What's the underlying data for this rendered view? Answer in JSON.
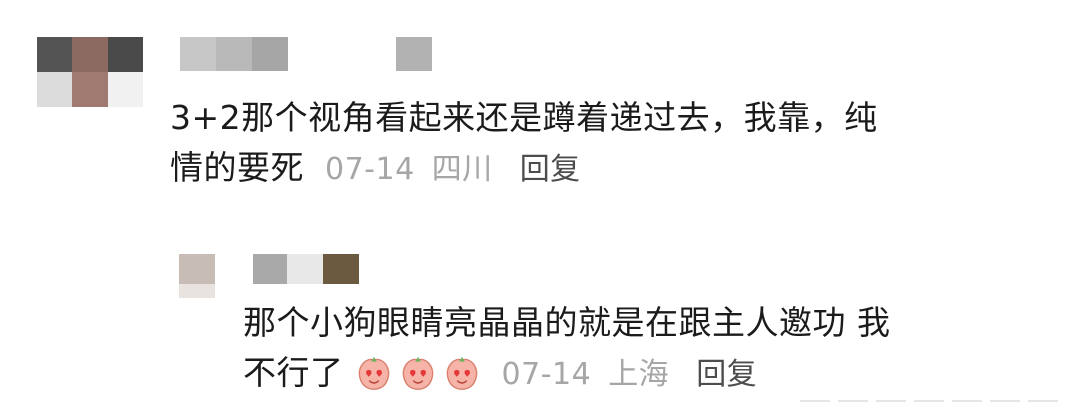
{
  "comments": [
    {
      "text_line1": "3+2那个视角看起来还是蹲着递过去，我靠，纯",
      "text_line2": "情的要死",
      "date": "07-14",
      "location": "四川",
      "reply_label": "回复"
    },
    {
      "text_line1": "那个小狗眼睛亮晶晶的就是在跟主人邀功 我",
      "text_line2": "不行了",
      "date": "07-14",
      "location": "上海",
      "reply_label": "回复"
    }
  ],
  "icons": {
    "reaction_emoji": "heart-eyes-peach-emoji",
    "avatar": "pixelated-avatar"
  },
  "colors": {
    "meta_gray": "#a6a6a6",
    "text": "#1b1b1b"
  }
}
